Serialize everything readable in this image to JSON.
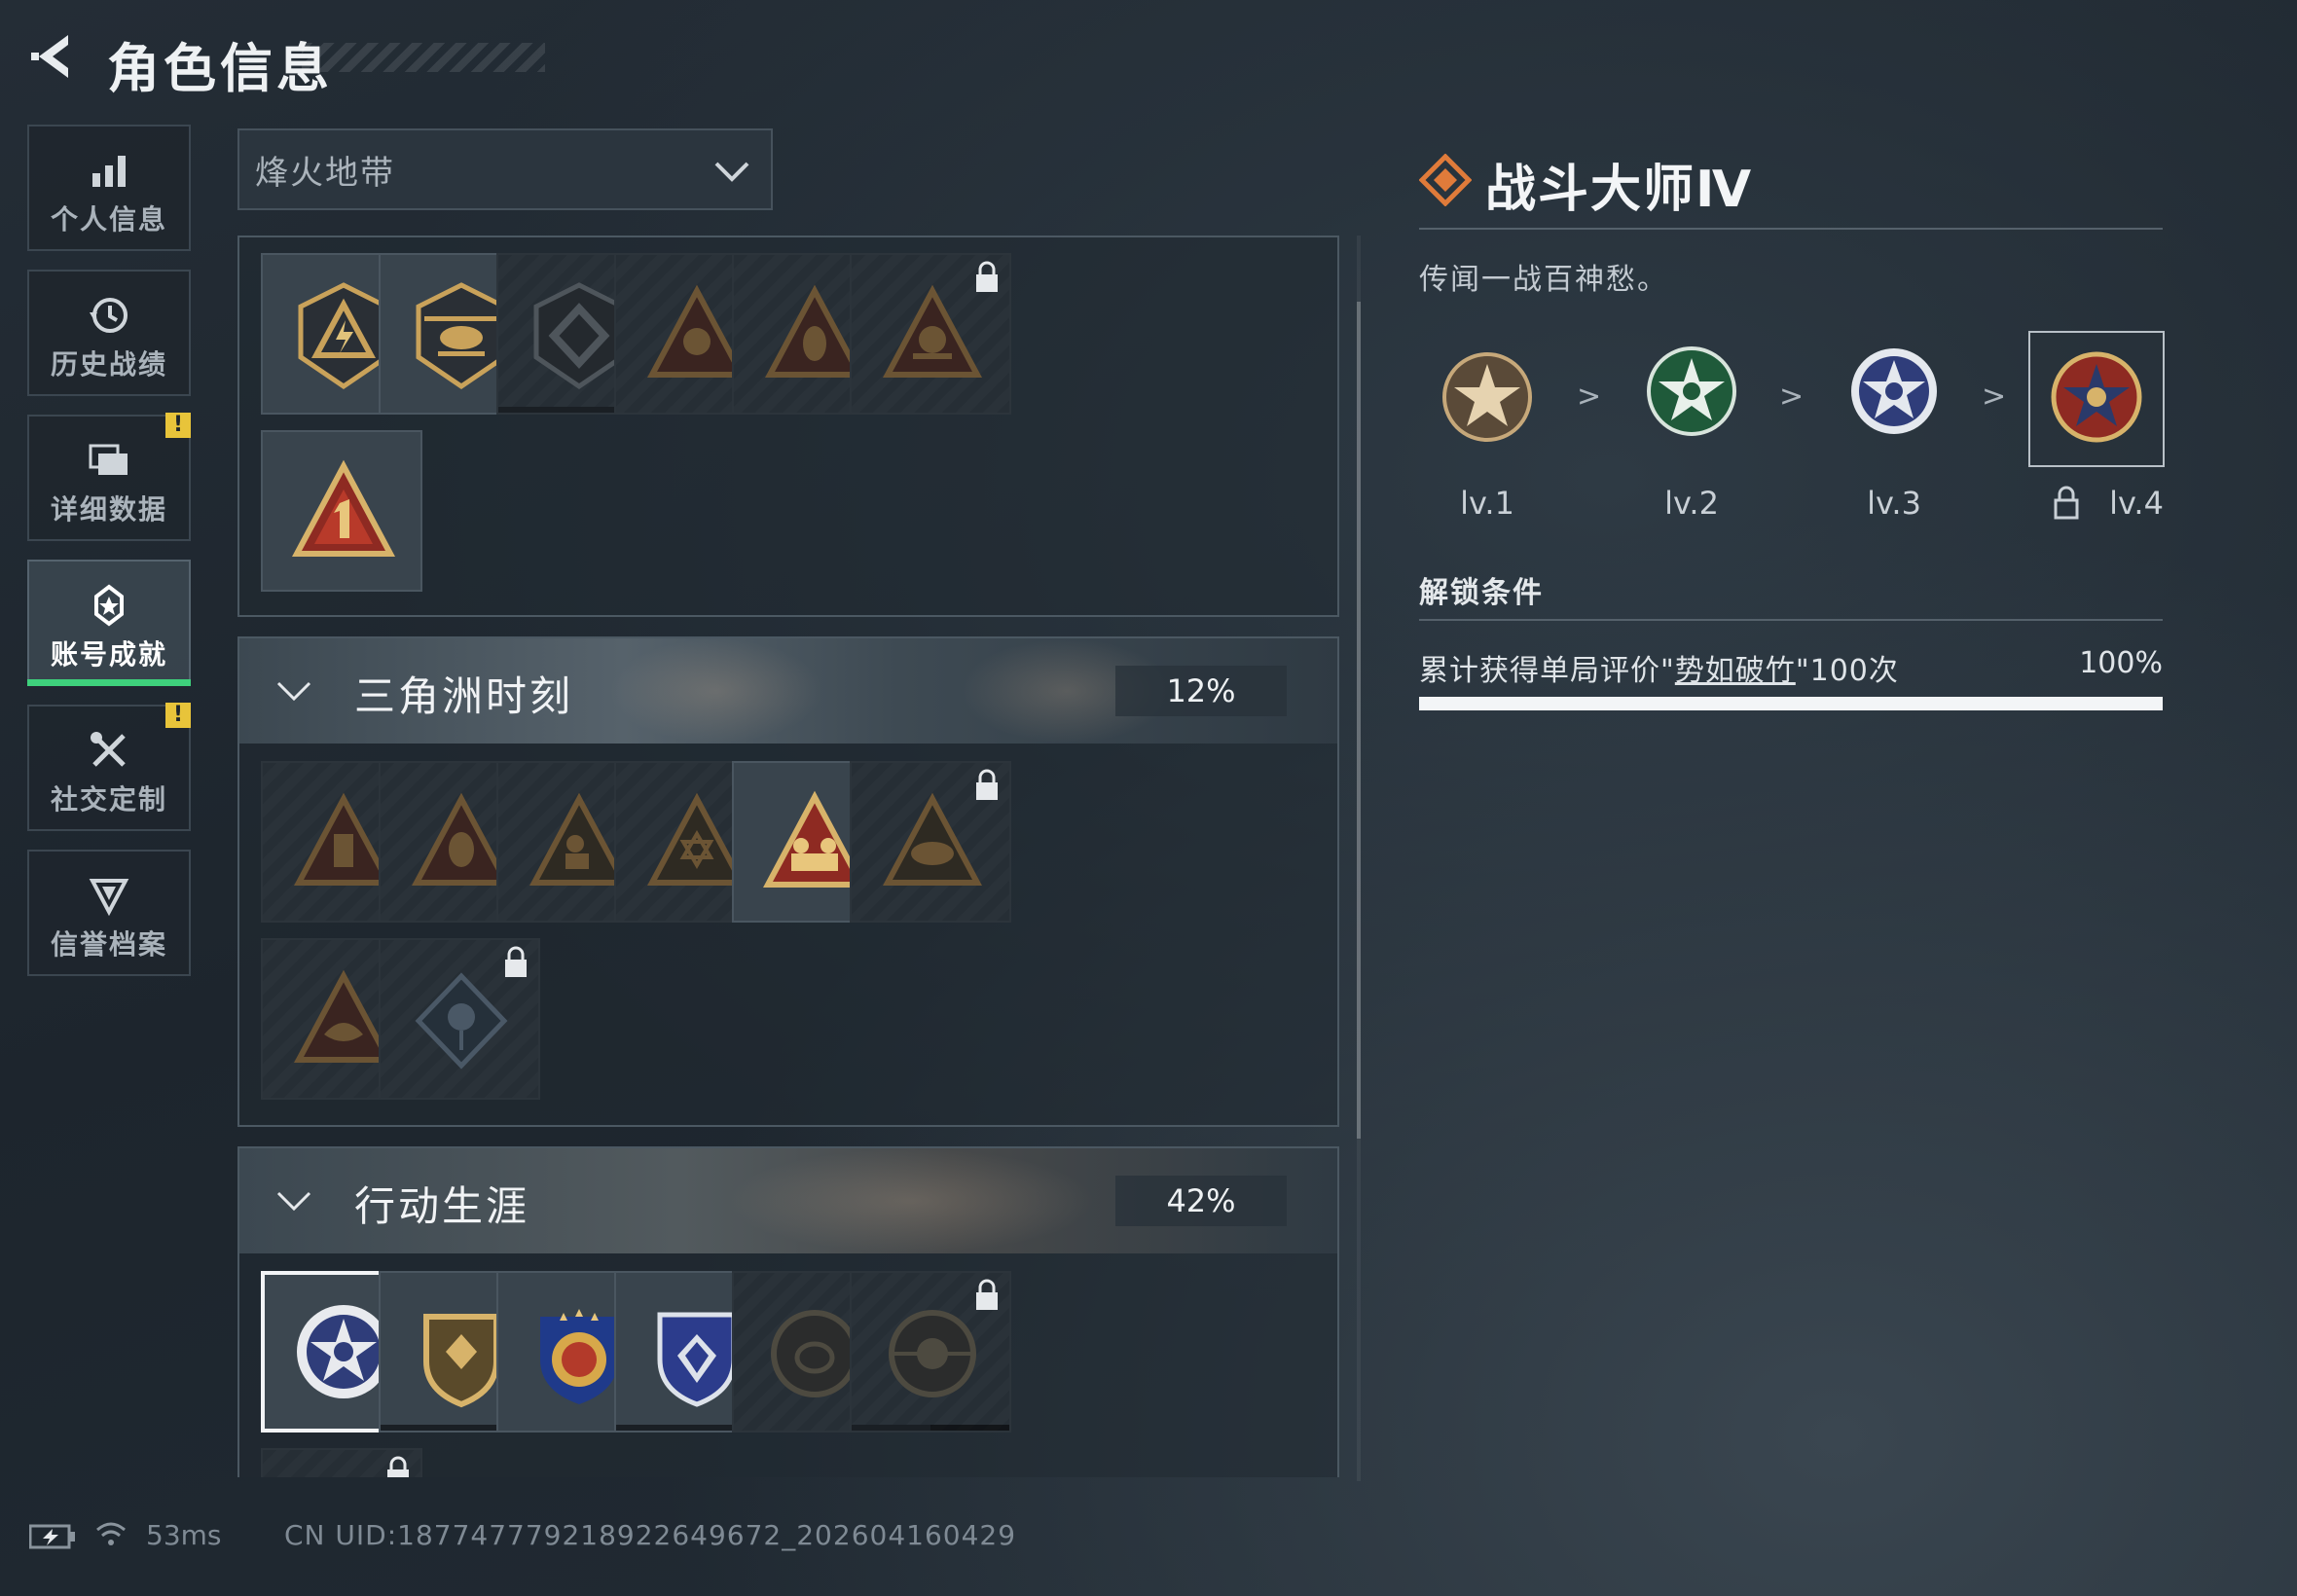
{
  "header": {
    "title": "角色信息",
    "back_icon": "back-arrow-icon"
  },
  "sidebar": {
    "items": [
      {
        "label": "个人信息",
        "icon": "bar-chart-icon",
        "active": false,
        "warning": ""
      },
      {
        "label": "历史战绩",
        "icon": "history-clock-icon",
        "active": false,
        "warning": ""
      },
      {
        "label": "详细数据",
        "icon": "folders-icon",
        "active": false,
        "warning": "!"
      },
      {
        "label": "账号成就",
        "icon": "achievement-icon",
        "active": true,
        "warning": ""
      },
      {
        "label": "社交定制",
        "icon": "tools-icon",
        "active": false,
        "warning": "!"
      },
      {
        "label": "信誉档案",
        "icon": "reputation-icon",
        "active": false,
        "warning": ""
      }
    ]
  },
  "filter": {
    "selected": "烽火地带",
    "icon": "chevron-down-icon"
  },
  "sections": [
    {
      "title": "",
      "percent": ""
    },
    {
      "title": "三角洲时刻",
      "percent": "12%"
    },
    {
      "title": "行动生涯",
      "percent": "42%"
    }
  ],
  "detail": {
    "title": "战斗大师Ⅳ",
    "description": "传闻一战百神愁。",
    "levels": [
      "lv.1",
      "lv.2",
      "lv.3",
      "lv.4"
    ],
    "level_arrow": ">",
    "unlock_heading": "解锁条件",
    "condition_prefix": "累计获得单局评价\"",
    "condition_link": "势如破竹",
    "condition_suffix": "\"100次",
    "condition_percent": "100%",
    "condition_progress": 1.0
  },
  "status": {
    "ping": "53ms",
    "uid": "CN UID:18774777921892264967​2_202604160429"
  },
  "colors": {
    "accent_green": "#3ed17c",
    "warning_yellow": "#e8c43a",
    "gold": "#c9a25a",
    "emblem_red": "#8e2a22"
  }
}
